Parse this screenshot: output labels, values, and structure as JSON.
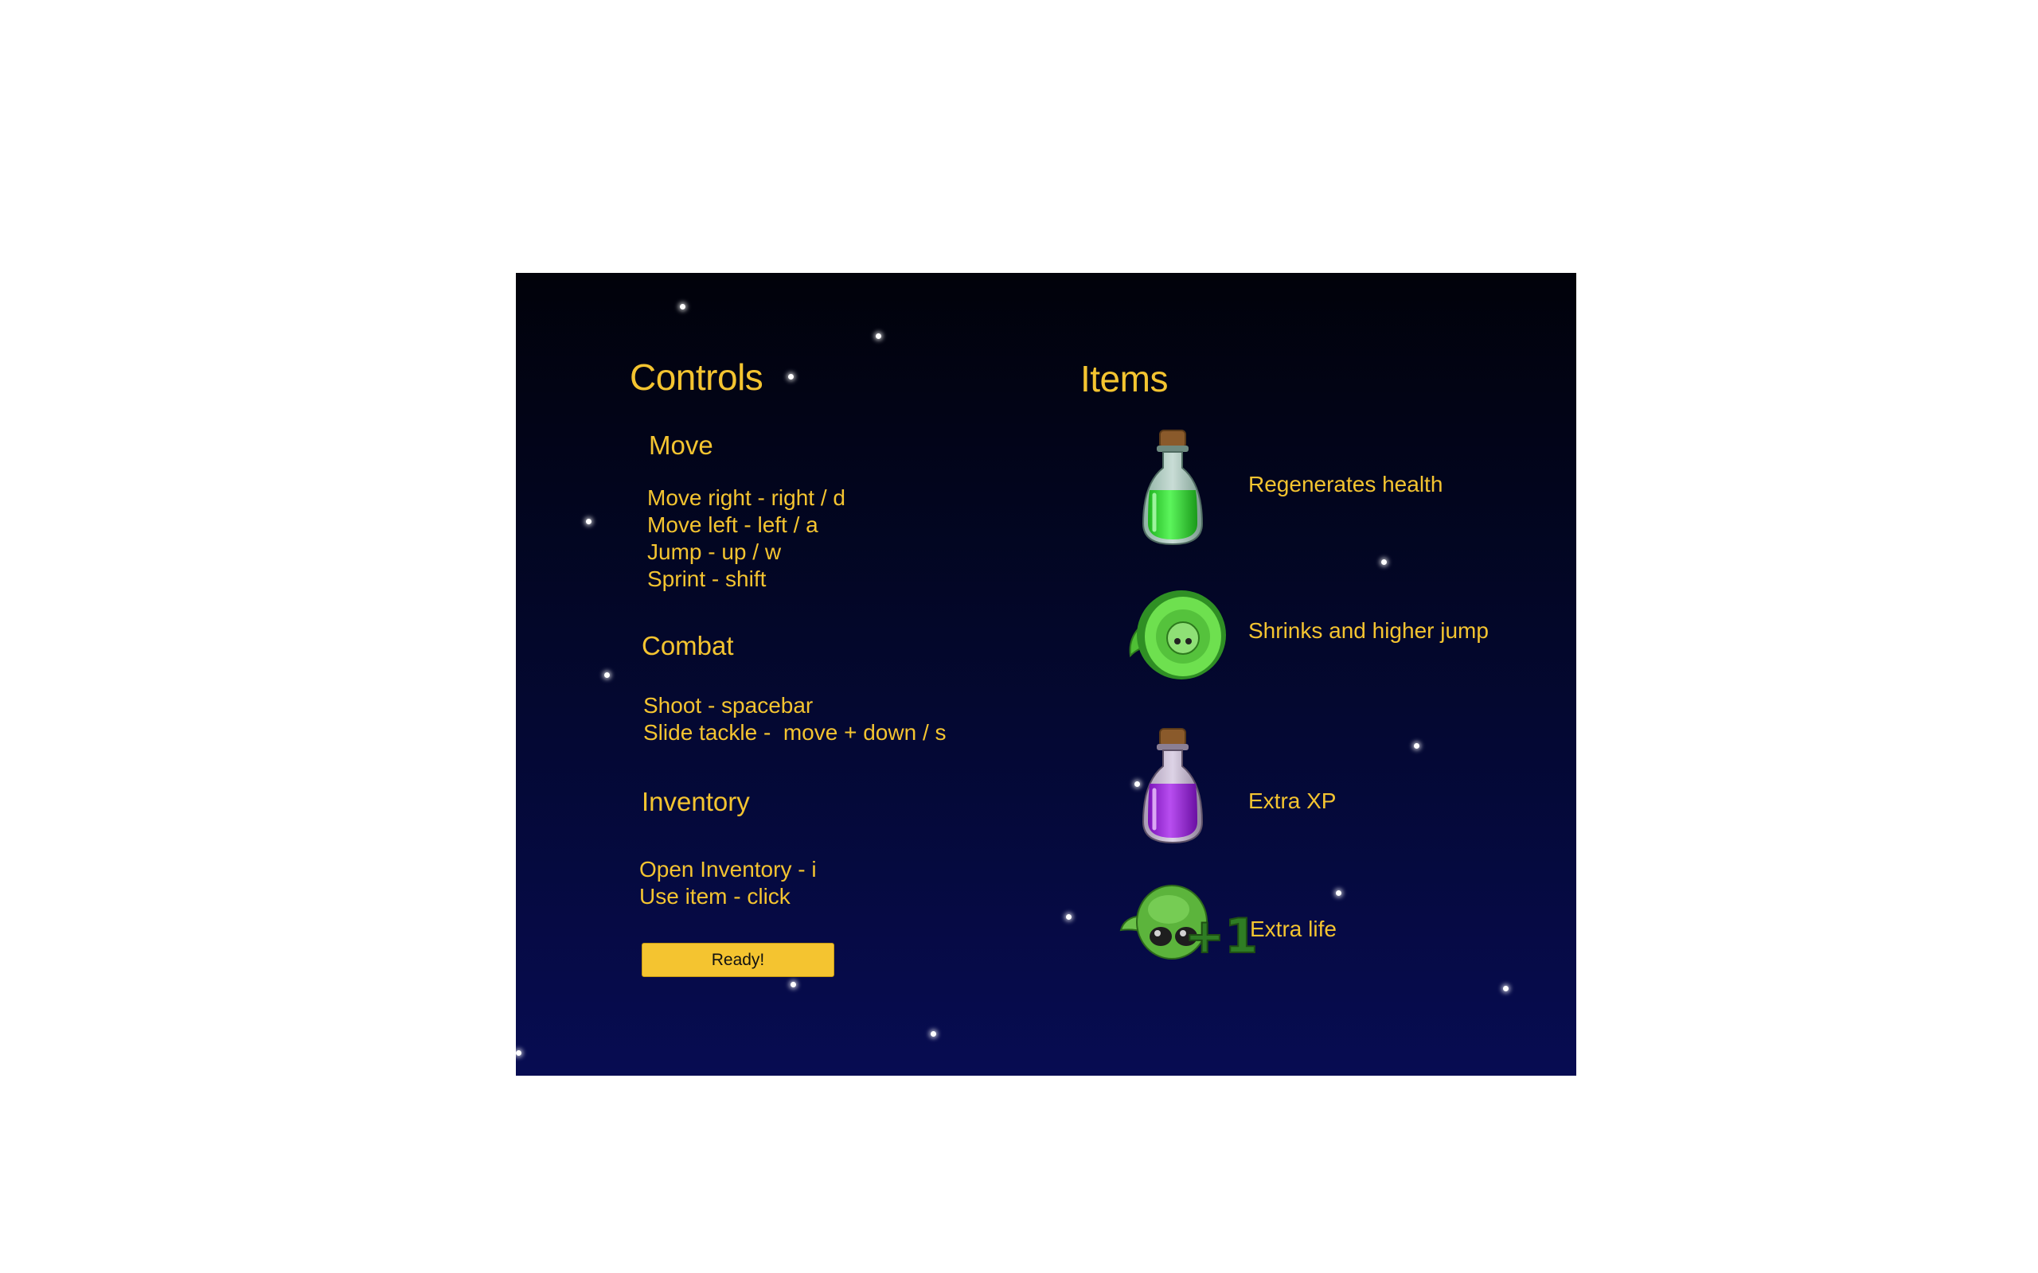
{
  "controls": {
    "title": "Controls",
    "move": {
      "heading": "Move",
      "lines": [
        "Move right - right / d",
        "Move left - left / a",
        "Jump - up / w",
        "Sprint - shift"
      ]
    },
    "combat": {
      "heading": "Combat",
      "lines": [
        "Shoot - spacebar",
        "Slide tackle -  move + down / s"
      ]
    },
    "inventory": {
      "heading": "Inventory",
      "lines": [
        "Open Inventory - i",
        "Use item - click"
      ]
    },
    "ready_label": "Ready!"
  },
  "items": {
    "title": "Items",
    "list": [
      {
        "icon": "green-potion-icon",
        "label": "Regenerates health"
      },
      {
        "icon": "shrink-alien-icon",
        "label": "Shrinks and higher jump"
      },
      {
        "icon": "purple-potion-icon",
        "label": "Extra XP"
      },
      {
        "icon": "alien-head-plus-one-icon",
        "label": "Extra life",
        "badge": "+1"
      }
    ]
  },
  "colors": {
    "text": "#f4c430",
    "button": "#f4c430",
    "background_top": "#01020a",
    "background_bottom": "#070c52"
  }
}
